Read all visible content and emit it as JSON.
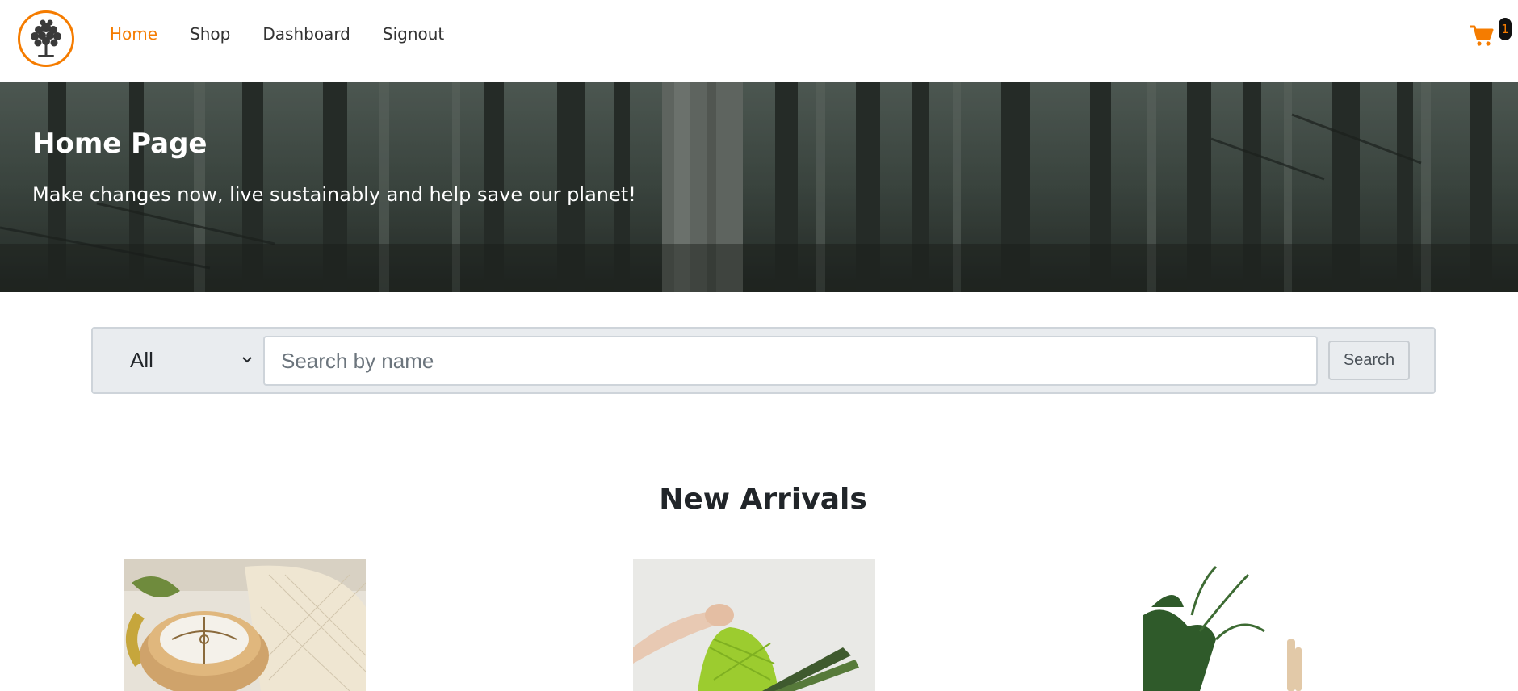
{
  "navbar": {
    "logo_icon": "tree-icon",
    "links": [
      {
        "label": "Home",
        "active": true
      },
      {
        "label": "Shop",
        "active": false
      },
      {
        "label": "Dashboard",
        "active": false
      },
      {
        "label": "Signout",
        "active": false
      }
    ],
    "cart_icon": "shopping-cart-icon",
    "cart_count": "1"
  },
  "hero": {
    "title": "Home Page",
    "subtitle": "Make changes now, live sustainably and help save our planet!"
  },
  "search": {
    "category_selected": "All",
    "placeholder": "Search by name",
    "value": "",
    "button_label": "Search"
  },
  "arrivals": {
    "title": "New Arrivals"
  },
  "colors": {
    "accent": "#f57c00",
    "text": "#333333",
    "search_bg": "#e9ecef"
  }
}
